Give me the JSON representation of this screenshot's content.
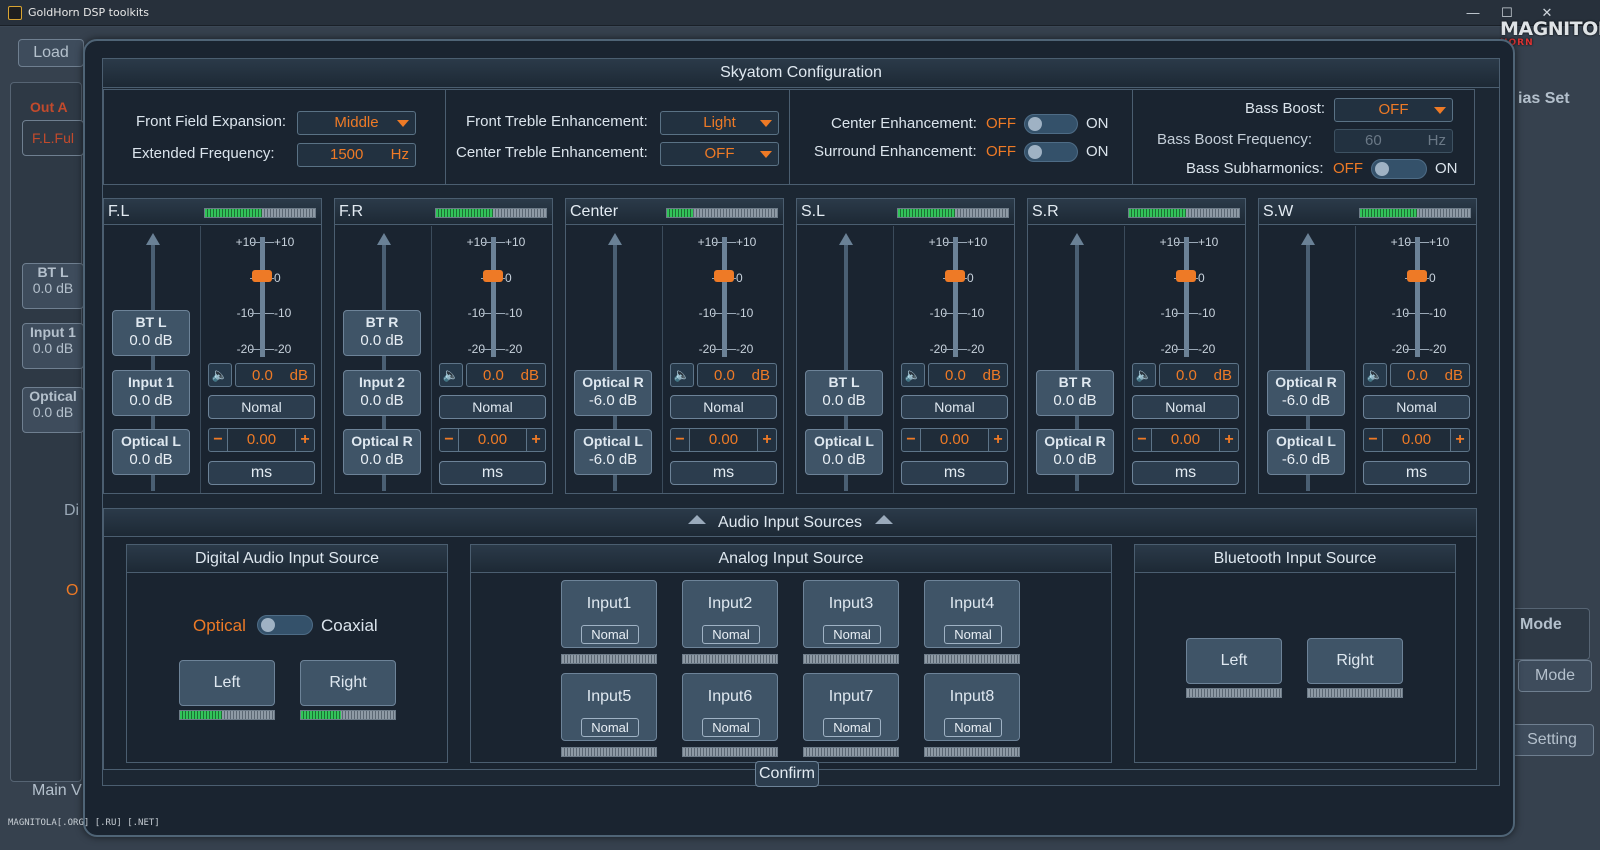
{
  "window": {
    "title": "GoldHorn DSP toolkits",
    "minimize": "—",
    "maximize": "☐",
    "close": "✕"
  },
  "logo": {
    "text": "MAGNITOLA",
    "sub": "HORN"
  },
  "background": {
    "load_button": "Load",
    "out_label": "Out A",
    "out_value": "F.L.Ful",
    "rows": [
      {
        "label": "BT L",
        "value": "0.0 dB"
      },
      {
        "label": "Input 1",
        "value": "0.0 dB"
      },
      {
        "label": "Optical",
        "value": "0.0 dB"
      }
    ],
    "di_label": "Di",
    "o_label": "O",
    "bias_set": "ias Set",
    "mode_title": "Mode",
    "mode_button": "Mode",
    "setting_button": "Setting",
    "main_label": "Main V"
  },
  "dialog": {
    "title": "Skyatom Configuration",
    "settings": {
      "front_field_expansion_label": "Front Field Expansion:",
      "front_field_expansion_value": "Middle",
      "extended_frequency_label": "Extended Frequency:",
      "extended_frequency_value": "1500",
      "extended_frequency_unit": "Hz",
      "front_treble_label": "Front Treble Enhancement:",
      "front_treble_value": "Light",
      "center_treble_label": "Center Treble Enhancement:",
      "center_treble_value": "OFF",
      "center_enh_label": "Center Enhancement:",
      "surround_enh_label": "Surround Enhancement:",
      "off_text": "OFF",
      "on_text": "ON",
      "bass_boost_label": "Bass Boost:",
      "bass_boost_value": "OFF",
      "bass_boost_freq_label": "Bass Boost Frequency:",
      "bass_boost_freq_value": "60",
      "bass_boost_freq_unit": "Hz",
      "bass_sub_label": "Bass Subharmonics:"
    },
    "channels": [
      {
        "name": "F.L",
        "level": 0.52,
        "sources": [
          {
            "title": "BT L",
            "value": "0.0 dB"
          },
          {
            "title": "Input 1",
            "value": "0.0 dB"
          },
          {
            "title": "Optical L",
            "value": "0.0 dB"
          }
        ],
        "gain": "0.0",
        "mode": "Nomal",
        "delay": "0.00",
        "unit": "ms"
      },
      {
        "name": "F.R",
        "level": 0.52,
        "sources": [
          {
            "title": "BT R",
            "value": "0.0 dB"
          },
          {
            "title": "Input 2",
            "value": "0.0 dB"
          },
          {
            "title": "Optical R",
            "value": "0.0 dB"
          }
        ],
        "gain": "0.0",
        "mode": "Nomal",
        "delay": "0.00",
        "unit": "ms"
      },
      {
        "name": "Center",
        "level": 0.24,
        "sources": [
          {
            "title": "Optical R",
            "value": "-6.0 dB"
          },
          {
            "title": "Optical L",
            "value": "-6.0 dB"
          }
        ],
        "gain": "0.0",
        "mode": "Nomal",
        "delay": "0.00",
        "unit": "ms"
      },
      {
        "name": "S.L",
        "level": 0.52,
        "sources": [
          {
            "title": "BT L",
            "value": "0.0 dB"
          },
          {
            "title": "Optical L",
            "value": "0.0 dB"
          }
        ],
        "gain": "0.0",
        "mode": "Nomal",
        "delay": "0.00",
        "unit": "ms"
      },
      {
        "name": "S.R",
        "level": 0.52,
        "sources": [
          {
            "title": "BT R",
            "value": "0.0 dB"
          },
          {
            "title": "Optical R",
            "value": "0.0 dB"
          }
        ],
        "gain": "0.0",
        "mode": "Nomal",
        "delay": "0.00",
        "unit": "ms"
      },
      {
        "name": "S.W",
        "level": 0.52,
        "sources": [
          {
            "title": "Optical R",
            "value": "-6.0 dB"
          },
          {
            "title": "Optical L",
            "value": "-6.0 dB"
          }
        ],
        "gain": "0.0",
        "mode": "Nomal",
        "delay": "0.00",
        "unit": "ms"
      }
    ],
    "db_unit": "dB",
    "scale_labels": [
      "+10",
      "0",
      "-10",
      "-20"
    ],
    "audio_sources": {
      "title": "Audio Input Sources",
      "digital": {
        "title": "Digital Audio Input Source",
        "optical": "Optical",
        "coaxial": "Coaxial",
        "left": "Left",
        "right": "Right",
        "left_level": 0.45,
        "right_level": 0.43
      },
      "analog": {
        "title": "Analog Input Source",
        "inputs": [
          "Input1",
          "Input2",
          "Input3",
          "Input4",
          "Input5",
          "Input6",
          "Input7",
          "Input8"
        ],
        "mode": "Nomal"
      },
      "bluetooth": {
        "title": "Bluetooth Input Source",
        "left": "Left",
        "right": "Right"
      }
    },
    "confirm": "Confirm"
  },
  "watermark": "MAGNITOLA[.ORG] [.RU] [.NET]",
  "colors": {
    "accent": "#ee7a26",
    "meter_green": "#32c45a"
  }
}
